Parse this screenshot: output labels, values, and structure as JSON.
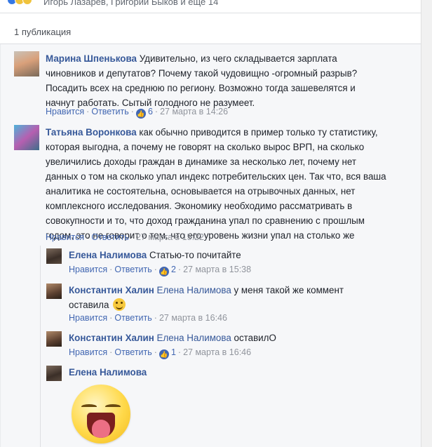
{
  "topbar": {
    "reactors_text": "Игорь Лазарев, Григорий Быков и еще 14"
  },
  "publications": {
    "label": "1 публикация"
  },
  "actions": {
    "like": "Нравится",
    "reply": "Ответить",
    "sep": "·"
  },
  "comments": [
    {
      "author": "Марина Шпенькова",
      "text_lines": [
        "Удивительно, из чего складывается зарплата",
        "чиновников и депутатов? Почему такой чудовищно -огромный разрыв?",
        "Посадить всех на среднюю по региону. Возможно тогда зашевелятся и",
        "начнут работать. Сытый голодного не разумеет."
      ],
      "likes": "6",
      "time": "27 марта в 14:26"
    },
    {
      "author": "Татьяна Воронкова",
      "text_lines": [
        "как обычно приводится в пример только ту статистику,",
        "которая выгодна, а почему не говорят на сколько вырос ВРП, на сколько",
        "увеличились доходы граждан в динамике за несколько лет, почему нет",
        "данных о том на сколько упал индекс потребительских цен. Так что, вся ваша",
        "аналитика не состоятельна, основывается на отрывочных данных, нет",
        "комплексного исследования. Экономику необходимо рассматривать в",
        "совокупности и то, что доход гражданина упал по сравнению с прошлым",
        "годом, это не говорит о том, что его уровень жизни упал на столько же"
      ],
      "time": "27 марта в 15:22"
    }
  ],
  "replies": [
    {
      "author": "Елена Налимова",
      "text": "Статью-то почитайте",
      "likes": "2",
      "time": "27 марта в 15:38"
    },
    {
      "author": "Константин Халин",
      "tag": "Елена Налимова",
      "text_line1": "у меня такой же коммент",
      "text_line2": "оставила",
      "time": "27 марта в 16:46"
    },
    {
      "author": "Константин Халин",
      "tag": "Елена Налимова",
      "text": "оставилО",
      "likes": "1",
      "time": "27 марта в 16:46"
    },
    {
      "author": "Елена Налимова"
    }
  ]
}
